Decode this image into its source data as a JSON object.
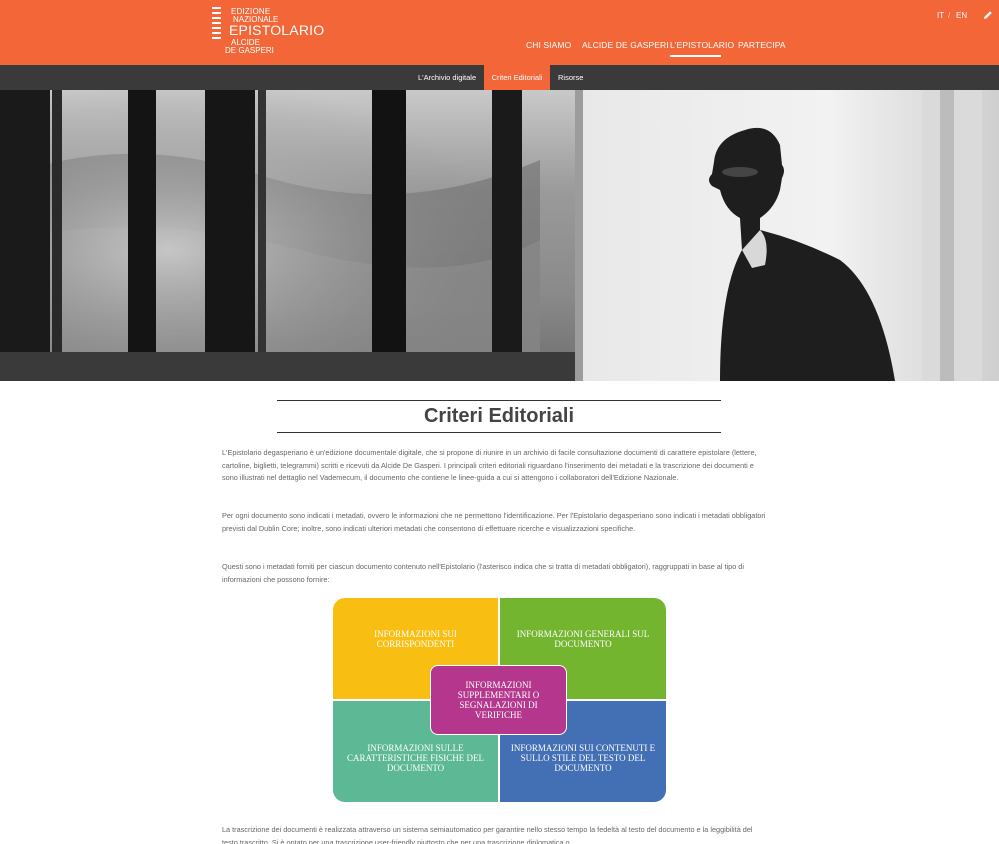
{
  "site": {
    "logo_lines": [
      "EDIZIONE",
      "NAZIONALE",
      "EPISTOLARIO",
      "ALCIDE",
      "DE GASPERI"
    ],
    "lang": {
      "it": "IT",
      "sep": "/",
      "en": "EN"
    },
    "edit_icon": "pencil-icon",
    "colors": {
      "accent": "#f26637",
      "subnav": "#3a3a3a"
    }
  },
  "main_nav": [
    {
      "label": "CHI SIAMO"
    },
    {
      "label": "ALCIDE DE GASPERI"
    },
    {
      "label": "L'EPISTOLARIO",
      "active": true
    },
    {
      "label": "PARTECIPA"
    }
  ],
  "sub_nav": [
    {
      "label": "L'Archivio digitale"
    },
    {
      "label": "Criteri Editoriali",
      "active": true
    },
    {
      "label": "Risorse"
    }
  ],
  "page": {
    "title": "Criteri Editoriali",
    "paragraphs": [
      "L'Epistolario degasperiano è un'edizione documentale digitale, che si propone di riunire in un archivio di facile consultazione documenti di carattere epistolare (lettere, cartoline, biglietti, telegrammi) scritti e ricevuti da Alcide De Gasperi. I principali criteri editoriali riguardano l'inserimento dei metadati e la trascrizione dei documenti e sono illustrati nel dettaglio nel Vademecum, il documento che contiene le linee-guida a cui si attengono i collaboratori dell'Edizione Nazionale.",
      "Per ogni documento sono indicati i metadati, ovvero le informazioni che ne permettono l'identificazione. Per l'Epistolario degasperiano sono indicati i metadati obbligatori previsti dal Dublin Core; inoltre, sono indicati ulteriori metadati che consentono di effettuare ricerche e visualizzazioni specifiche.",
      "Questi sono i metadati forniti per ciascun documento contenuto nell'Epistolario (l'asterisco indica che si tratta di metadati obbligatori), raggruppati in base al tipo di informazioni che possono fornire:",
      "La trascrizione dei documenti è realizzata attraverso un sistema semiautomatico per garantire nello stesso tempo la fedeltà al testo del documento e la leggibilità del testo trascritto. Si è optato per una trascrizione user-friendly piuttosto che per una trascrizione diplomatica o"
    ]
  },
  "diagram": {
    "top_left": "INFORMAZIONI SUI CORRISPONDENTI",
    "top_right": "INFORMAZIONI GENERALI SUL DOCUMENTO",
    "bottom_left": "INFORMAZIONI SULLE CARATTERISTICHE FISICHE DEL DOCUMENTO",
    "bottom_right": "INFORMAZIONI SUI CONTENUTI E SULLO STILE DEL TESTO DEL DOCUMENTO",
    "center": "INFORMAZIONI SUPPLEMENTARI O SEGNALAZIONI DI VERIFICHE",
    "colors": {
      "top_left": "#f9be12",
      "top_right": "#74b52f",
      "bottom_left": "#5cb895",
      "bottom_right": "#436fb5",
      "center": "#b5378d"
    }
  }
}
